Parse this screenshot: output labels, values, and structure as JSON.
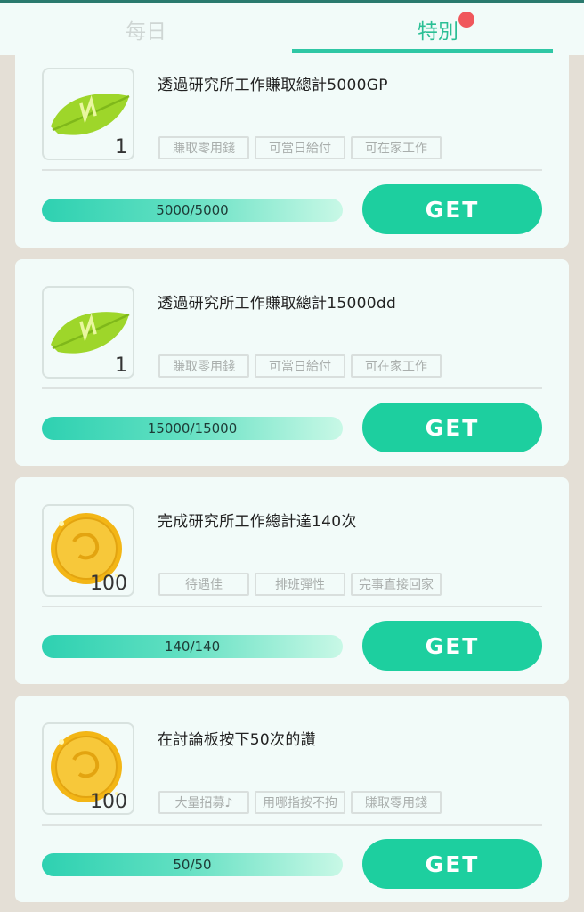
{
  "tabs": [
    {
      "label": "每日",
      "active": false
    },
    {
      "label": "特別",
      "active": true,
      "has_notification": true
    }
  ],
  "colors": {
    "accent": "#1dcf9f",
    "tab_active": "#2bbf95",
    "notification": "#f0575c",
    "card_bg": "#f2fbf9",
    "page_bg": "#e4dfd6"
  },
  "missions": [
    {
      "title": "透過研究所工作賺取總計5000GP",
      "reward_icon": "leaf-icon",
      "reward_qty": "1",
      "tags": [
        "賺取零用錢",
        "可當日給付",
        "可在家工作"
      ],
      "progress_text": "5000/5000",
      "progress": 1.0,
      "button_label": "GET"
    },
    {
      "title": "透過研究所工作賺取總計15000dd",
      "reward_icon": "leaf-icon",
      "reward_qty": "1",
      "tags": [
        "賺取零用錢",
        "可當日給付",
        "可在家工作"
      ],
      "progress_text": "15000/15000",
      "progress": 1.0,
      "button_label": "GET"
    },
    {
      "title": "完成研究所工作總計達140次",
      "reward_icon": "gold-coin-icon",
      "reward_qty": "100",
      "tags": [
        "待遇佳",
        "排班彈性",
        "完事直接回家"
      ],
      "progress_text": "140/140",
      "progress": 1.0,
      "button_label": "GET"
    },
    {
      "title": "在討論板按下50次的讚",
      "reward_icon": "gold-coin-icon",
      "reward_qty": "100",
      "tags": [
        "大量招募♪",
        "用哪指按不拘",
        "賺取零用錢"
      ],
      "progress_text": "50/50",
      "progress": 1.0,
      "button_label": "GET"
    }
  ]
}
